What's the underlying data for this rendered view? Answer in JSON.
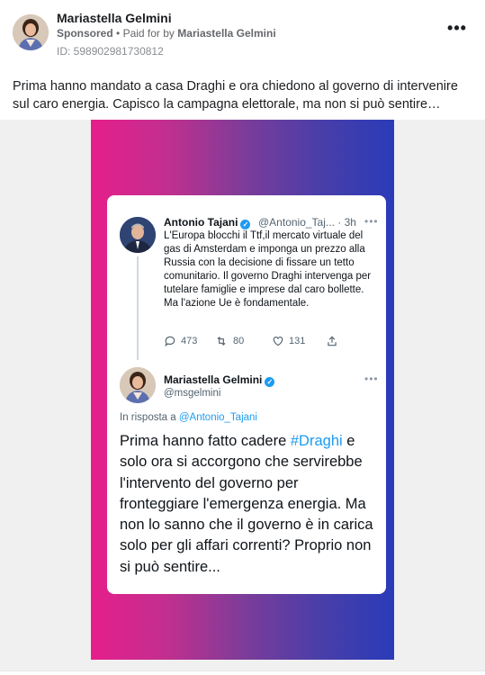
{
  "post": {
    "author": "Mariastella Gelmini",
    "sponsored_label": "Sponsored",
    "paid_prefix": "Paid for by",
    "paid_by": "Mariastella Gelmini",
    "ad_id": "ID: 598902981730812",
    "more_label": "•••",
    "text": "Prima hanno mandato a casa Draghi e ora chiedono al governo di intervenire sul caro energia. Capisco la campagna elettorale, ma non si può sentire…"
  },
  "tweet1": {
    "name": "Antonio Tajani",
    "handle": "@Antonio_Taj...",
    "time": "3h",
    "text": "L'Europa blocchi  il Ttf,il mercato virtuale del gas di Amsterdam e imponga un prezzo alla Russia con la decisione di fissare un tetto comunitario. Il governo Draghi intervenga per tutelare famiglie e imprese dal caro bollette. Ma l'azione Ue è fondamentale.",
    "replies": "473",
    "retweets": "80",
    "likes": "131"
  },
  "tweet2": {
    "name": "Mariastella Gelmini",
    "handle": "@msgelmini",
    "reply_prefix": "In risposta a",
    "reply_to": "@Antonio_Tajani",
    "text_before": "Prima hanno fatto cadere ",
    "hashtag": "#Draghi",
    "text_after": " e solo ora si accorgono che servirebbe l'intervento del governo per fronteggiare l'emergenza energia. Ma non lo sanno che il governo è in carica solo per gli affari correnti? Proprio non si può sentire..."
  },
  "colors": {
    "gradient_left": "#e61e8c",
    "gradient_right": "#2a3bb8",
    "link_blue": "#1d9bf0",
    "media_bg": "#f0f0f0"
  }
}
